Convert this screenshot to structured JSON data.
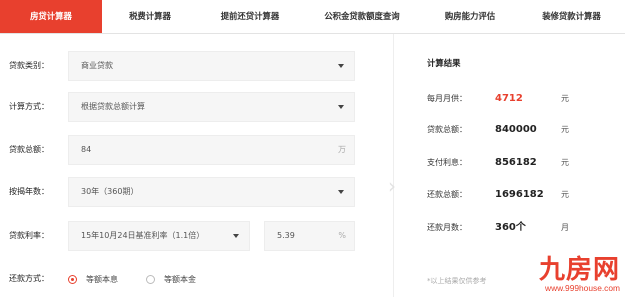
{
  "tabs": [
    {
      "label": "房贷计算器",
      "active": true
    },
    {
      "label": "税费计算器",
      "active": false
    },
    {
      "label": "提前还贷计算器",
      "active": false
    },
    {
      "label": "公积金贷款额度查询",
      "active": false
    },
    {
      "label": "购房能力评估",
      "active": false
    },
    {
      "label": "装修贷款计算器",
      "active": false
    }
  ],
  "form": {
    "loan_type": {
      "label": "贷款类别：",
      "value": "商业贷款"
    },
    "calc_method": {
      "label": "计算方式：",
      "value": "根据贷款总额计算"
    },
    "loan_total": {
      "label": "贷款总额：",
      "value": "84",
      "unit": "万"
    },
    "mortgage_years": {
      "label": "按揭年数：",
      "value": "30年（360期）"
    },
    "loan_rate": {
      "label": "贷款利率：",
      "value": "15年10月24日基准利率（1.1倍）",
      "rate": "5.39",
      "unit": "%"
    },
    "repayment": {
      "label": "还款方式：",
      "options": [
        {
          "label": "等额本息",
          "selected": true
        },
        {
          "label": "等额本金",
          "selected": false
        }
      ]
    }
  },
  "results": {
    "title": "计算结果",
    "monthly": {
      "label": "每月月供：",
      "value": "4712",
      "unit": "元"
    },
    "loan_total": {
      "label": "贷款总额：",
      "value": "840000",
      "unit": "元"
    },
    "interest": {
      "label": "支付利息：",
      "value": "856182",
      "unit": "元"
    },
    "repay_total": {
      "label": "还款总额：",
      "value": "1696182",
      "unit": "元"
    },
    "months": {
      "label": "还款月数：",
      "value": "360个",
      "unit": "月"
    },
    "note": "*以上结果仅供参考"
  },
  "watermark": {
    "logo": "九房网",
    "url": "www.999house.com"
  },
  "colors": {
    "accent": "#e8402e"
  }
}
